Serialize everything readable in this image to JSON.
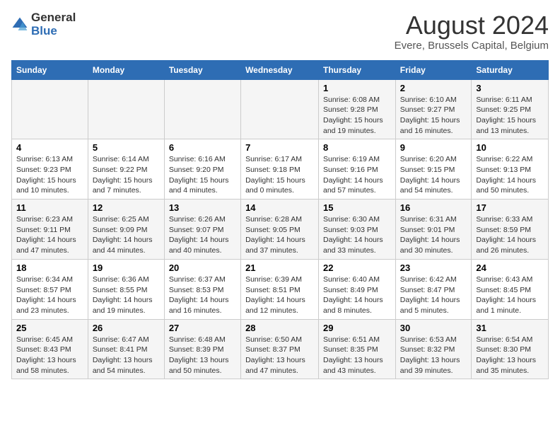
{
  "header": {
    "logo_general": "General",
    "logo_blue": "Blue",
    "main_title": "August 2024",
    "subtitle": "Evere, Brussels Capital, Belgium"
  },
  "days_of_week": [
    "Sunday",
    "Monday",
    "Tuesday",
    "Wednesday",
    "Thursday",
    "Friday",
    "Saturday"
  ],
  "weeks": [
    [
      {
        "day": "",
        "sunrise": "",
        "sunset": "",
        "daylight": ""
      },
      {
        "day": "",
        "sunrise": "",
        "sunset": "",
        "daylight": ""
      },
      {
        "day": "",
        "sunrise": "",
        "sunset": "",
        "daylight": ""
      },
      {
        "day": "",
        "sunrise": "",
        "sunset": "",
        "daylight": ""
      },
      {
        "day": "1",
        "sunrise": "6:08 AM",
        "sunset": "9:28 PM",
        "daylight": "15 hours and 19 minutes."
      },
      {
        "day": "2",
        "sunrise": "6:10 AM",
        "sunset": "9:27 PM",
        "daylight": "15 hours and 16 minutes."
      },
      {
        "day": "3",
        "sunrise": "6:11 AM",
        "sunset": "9:25 PM",
        "daylight": "15 hours and 13 minutes."
      }
    ],
    [
      {
        "day": "4",
        "sunrise": "6:13 AM",
        "sunset": "9:23 PM",
        "daylight": "15 hours and 10 minutes."
      },
      {
        "day": "5",
        "sunrise": "6:14 AM",
        "sunset": "9:22 PM",
        "daylight": "15 hours and 7 minutes."
      },
      {
        "day": "6",
        "sunrise": "6:16 AM",
        "sunset": "9:20 PM",
        "daylight": "15 hours and 4 minutes."
      },
      {
        "day": "7",
        "sunrise": "6:17 AM",
        "sunset": "9:18 PM",
        "daylight": "15 hours and 0 minutes."
      },
      {
        "day": "8",
        "sunrise": "6:19 AM",
        "sunset": "9:16 PM",
        "daylight": "14 hours and 57 minutes."
      },
      {
        "day": "9",
        "sunrise": "6:20 AM",
        "sunset": "9:15 PM",
        "daylight": "14 hours and 54 minutes."
      },
      {
        "day": "10",
        "sunrise": "6:22 AM",
        "sunset": "9:13 PM",
        "daylight": "14 hours and 50 minutes."
      }
    ],
    [
      {
        "day": "11",
        "sunrise": "6:23 AM",
        "sunset": "9:11 PM",
        "daylight": "14 hours and 47 minutes."
      },
      {
        "day": "12",
        "sunrise": "6:25 AM",
        "sunset": "9:09 PM",
        "daylight": "14 hours and 44 minutes."
      },
      {
        "day": "13",
        "sunrise": "6:26 AM",
        "sunset": "9:07 PM",
        "daylight": "14 hours and 40 minutes."
      },
      {
        "day": "14",
        "sunrise": "6:28 AM",
        "sunset": "9:05 PM",
        "daylight": "14 hours and 37 minutes."
      },
      {
        "day": "15",
        "sunrise": "6:30 AM",
        "sunset": "9:03 PM",
        "daylight": "14 hours and 33 minutes."
      },
      {
        "day": "16",
        "sunrise": "6:31 AM",
        "sunset": "9:01 PM",
        "daylight": "14 hours and 30 minutes."
      },
      {
        "day": "17",
        "sunrise": "6:33 AM",
        "sunset": "8:59 PM",
        "daylight": "14 hours and 26 minutes."
      }
    ],
    [
      {
        "day": "18",
        "sunrise": "6:34 AM",
        "sunset": "8:57 PM",
        "daylight": "14 hours and 23 minutes."
      },
      {
        "day": "19",
        "sunrise": "6:36 AM",
        "sunset": "8:55 PM",
        "daylight": "14 hours and 19 minutes."
      },
      {
        "day": "20",
        "sunrise": "6:37 AM",
        "sunset": "8:53 PM",
        "daylight": "14 hours and 16 minutes."
      },
      {
        "day": "21",
        "sunrise": "6:39 AM",
        "sunset": "8:51 PM",
        "daylight": "14 hours and 12 minutes."
      },
      {
        "day": "22",
        "sunrise": "6:40 AM",
        "sunset": "8:49 PM",
        "daylight": "14 hours and 8 minutes."
      },
      {
        "day": "23",
        "sunrise": "6:42 AM",
        "sunset": "8:47 PM",
        "daylight": "14 hours and 5 minutes."
      },
      {
        "day": "24",
        "sunrise": "6:43 AM",
        "sunset": "8:45 PM",
        "daylight": "14 hours and 1 minute."
      }
    ],
    [
      {
        "day": "25",
        "sunrise": "6:45 AM",
        "sunset": "8:43 PM",
        "daylight": "13 hours and 58 minutes."
      },
      {
        "day": "26",
        "sunrise": "6:47 AM",
        "sunset": "8:41 PM",
        "daylight": "13 hours and 54 minutes."
      },
      {
        "day": "27",
        "sunrise": "6:48 AM",
        "sunset": "8:39 PM",
        "daylight": "13 hours and 50 minutes."
      },
      {
        "day": "28",
        "sunrise": "6:50 AM",
        "sunset": "8:37 PM",
        "daylight": "13 hours and 47 minutes."
      },
      {
        "day": "29",
        "sunrise": "6:51 AM",
        "sunset": "8:35 PM",
        "daylight": "13 hours and 43 minutes."
      },
      {
        "day": "30",
        "sunrise": "6:53 AM",
        "sunset": "8:32 PM",
        "daylight": "13 hours and 39 minutes."
      },
      {
        "day": "31",
        "sunrise": "6:54 AM",
        "sunset": "8:30 PM",
        "daylight": "13 hours and 35 minutes."
      }
    ]
  ],
  "labels": {
    "sunrise": "Sunrise:",
    "sunset": "Sunset:",
    "daylight": "Daylight:"
  },
  "colors": {
    "header_bg": "#2e6db4",
    "accent": "#2e6db4"
  }
}
